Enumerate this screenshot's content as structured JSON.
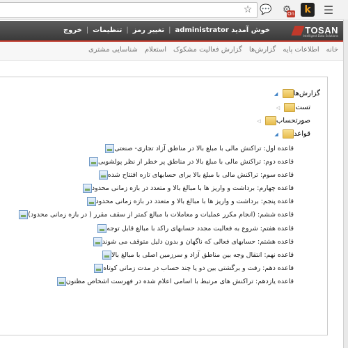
{
  "browser": {
    "icons": [
      "star-icon",
      "chat-icon",
      "network-icon",
      "k-extension-icon",
      "menu-icon"
    ],
    "badge": "On",
    "k_label": "k"
  },
  "header": {
    "logo_text": "TOSAN",
    "logo_sub": "Intelligent Data Solutions",
    "welcome": "خوش آمدید administrator",
    "change_password": "تغییر رمز",
    "settings": "تنظیمات",
    "logout": "خروج"
  },
  "navbar": {
    "items": [
      "خانه",
      "اطلاعات پایه",
      "گزارش‌ها",
      "گزارش فعالیت مشکوک",
      "استعلام",
      "شناسایی مشتری"
    ]
  },
  "tree": {
    "root": "گزارش‌ها",
    "folders": [
      "تست",
      "صورتحساب",
      "قواعد"
    ],
    "rules": [
      "قاعده اول: تراکنش مالی با مبلغ بالا در مناطق آزاد تجاری- صنعتی",
      "قاعده دوم: تراکنش مالی با مبلغ بالا در مناطق پر خطر از نظر پولشویی",
      "قاعده سوم: تراکنش مالی با مبلغ بالا برای حسابهای تازه افتتاح شده",
      "قاعده چهارم: برداشت و واریز ها با مبالغ بالا و متعدد در بازه زمانی محدود",
      "قاعده پنجم: برداشت و واریز ها با مبالغ بالا و متعدد در بازه زمانی محدود",
      "قاعده ششم: (انجام مکرر عملیات و معاملات با مبالغ کمتر از سقف مقرر ( در بازه زمانی محدود)",
      "قاعده هفتم: شروع به فعالیت مجدد حسابهای راکد با مبالغ قابل توجه",
      "قاعده هشتم: حسابهای فعالی که ناگهان و بدون دلیل متوقف می شوند",
      "قاعده نهم: انتقال وجه بین مناطق آزاد و سرزمین اصلی با مبالغ بالا",
      "قاعده دهم: رفت و برگشتی بین دو یا چند حساب در مدت زمانی کوتاه",
      "قاعده یازدهم: تراکنش های مرتبط با اسامی اعلام شده در فهرست اشخاص مظنون"
    ]
  }
}
